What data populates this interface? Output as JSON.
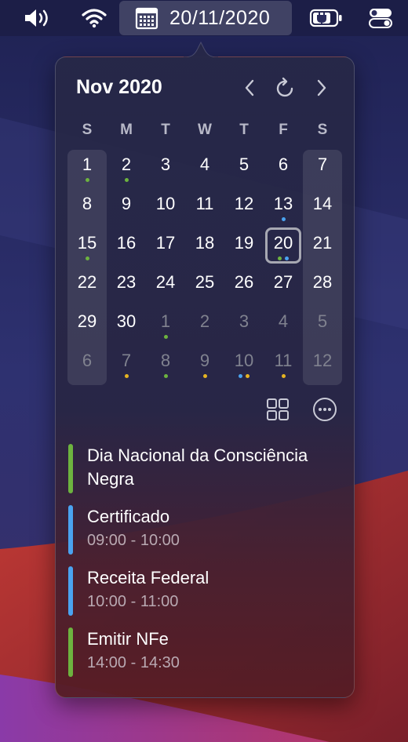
{
  "menubar": {
    "date_text": "20/11/2020",
    "icons": [
      "volume-icon",
      "wifi-icon",
      "calendar-icon",
      "battery-charging-icon",
      "control-center-icon"
    ]
  },
  "calendar": {
    "month_title": "Nov 2020",
    "weekdays": [
      "S",
      "M",
      "T",
      "W",
      "T",
      "F",
      "S"
    ],
    "weeks": [
      [
        {
          "d": "1",
          "dots": [
            "#6db33f"
          ]
        },
        {
          "d": "2",
          "dots": [
            "#6db33f"
          ]
        },
        {
          "d": "3"
        },
        {
          "d": "4"
        },
        {
          "d": "5"
        },
        {
          "d": "6"
        },
        {
          "d": "7"
        }
      ],
      [
        {
          "d": "8"
        },
        {
          "d": "9"
        },
        {
          "d": "10"
        },
        {
          "d": "11"
        },
        {
          "d": "12"
        },
        {
          "d": "13",
          "dots": [
            "#4aa3f0"
          ]
        },
        {
          "d": "14"
        }
      ],
      [
        {
          "d": "15",
          "dots": [
            "#6db33f"
          ]
        },
        {
          "d": "16"
        },
        {
          "d": "17"
        },
        {
          "d": "18"
        },
        {
          "d": "19"
        },
        {
          "d": "20",
          "today": true,
          "dots": [
            "#6db33f",
            "#4aa3f0"
          ]
        },
        {
          "d": "21"
        }
      ],
      [
        {
          "d": "22"
        },
        {
          "d": "23"
        },
        {
          "d": "24"
        },
        {
          "d": "25"
        },
        {
          "d": "26"
        },
        {
          "d": "27"
        },
        {
          "d": "28"
        }
      ],
      [
        {
          "d": "29"
        },
        {
          "d": "30"
        },
        {
          "d": "1",
          "other": true,
          "dots": [
            "#6db33f"
          ]
        },
        {
          "d": "2",
          "other": true
        },
        {
          "d": "3",
          "other": true
        },
        {
          "d": "4",
          "other": true
        },
        {
          "d": "5",
          "other": true
        }
      ],
      [
        {
          "d": "6",
          "other": true
        },
        {
          "d": "7",
          "other": true,
          "dots": [
            "#e6b422"
          ]
        },
        {
          "d": "8",
          "other": true,
          "dots": [
            "#6db33f"
          ]
        },
        {
          "d": "9",
          "other": true,
          "dots": [
            "#e6b422"
          ]
        },
        {
          "d": "10",
          "other": true,
          "dots": [
            "#4aa3f0",
            "#e6b422"
          ]
        },
        {
          "d": "11",
          "other": true,
          "dots": [
            "#e6b422"
          ]
        },
        {
          "d": "12",
          "other": true
        }
      ]
    ]
  },
  "events": [
    {
      "title_line1": "Dia Nacional da Consciência",
      "title_line2": "Negra",
      "time": "",
      "color": "#6db33f"
    },
    {
      "title_line1": "Certificado",
      "title_line2": "",
      "time": "09:00 - 10:00",
      "color": "#4aa3f0"
    },
    {
      "title_line1": "Receita Federal",
      "title_line2": "",
      "time": "10:00 - 11:00",
      "color": "#4aa3f0"
    },
    {
      "title_line1": "Emitir NFe",
      "title_line2": "",
      "time": "14:00 - 14:30",
      "color": "#6db33f"
    }
  ],
  "colors": {
    "today_ring": "#a7a8b2",
    "green": "#6db33f",
    "blue": "#4aa3f0",
    "yellow": "#e6b422"
  }
}
